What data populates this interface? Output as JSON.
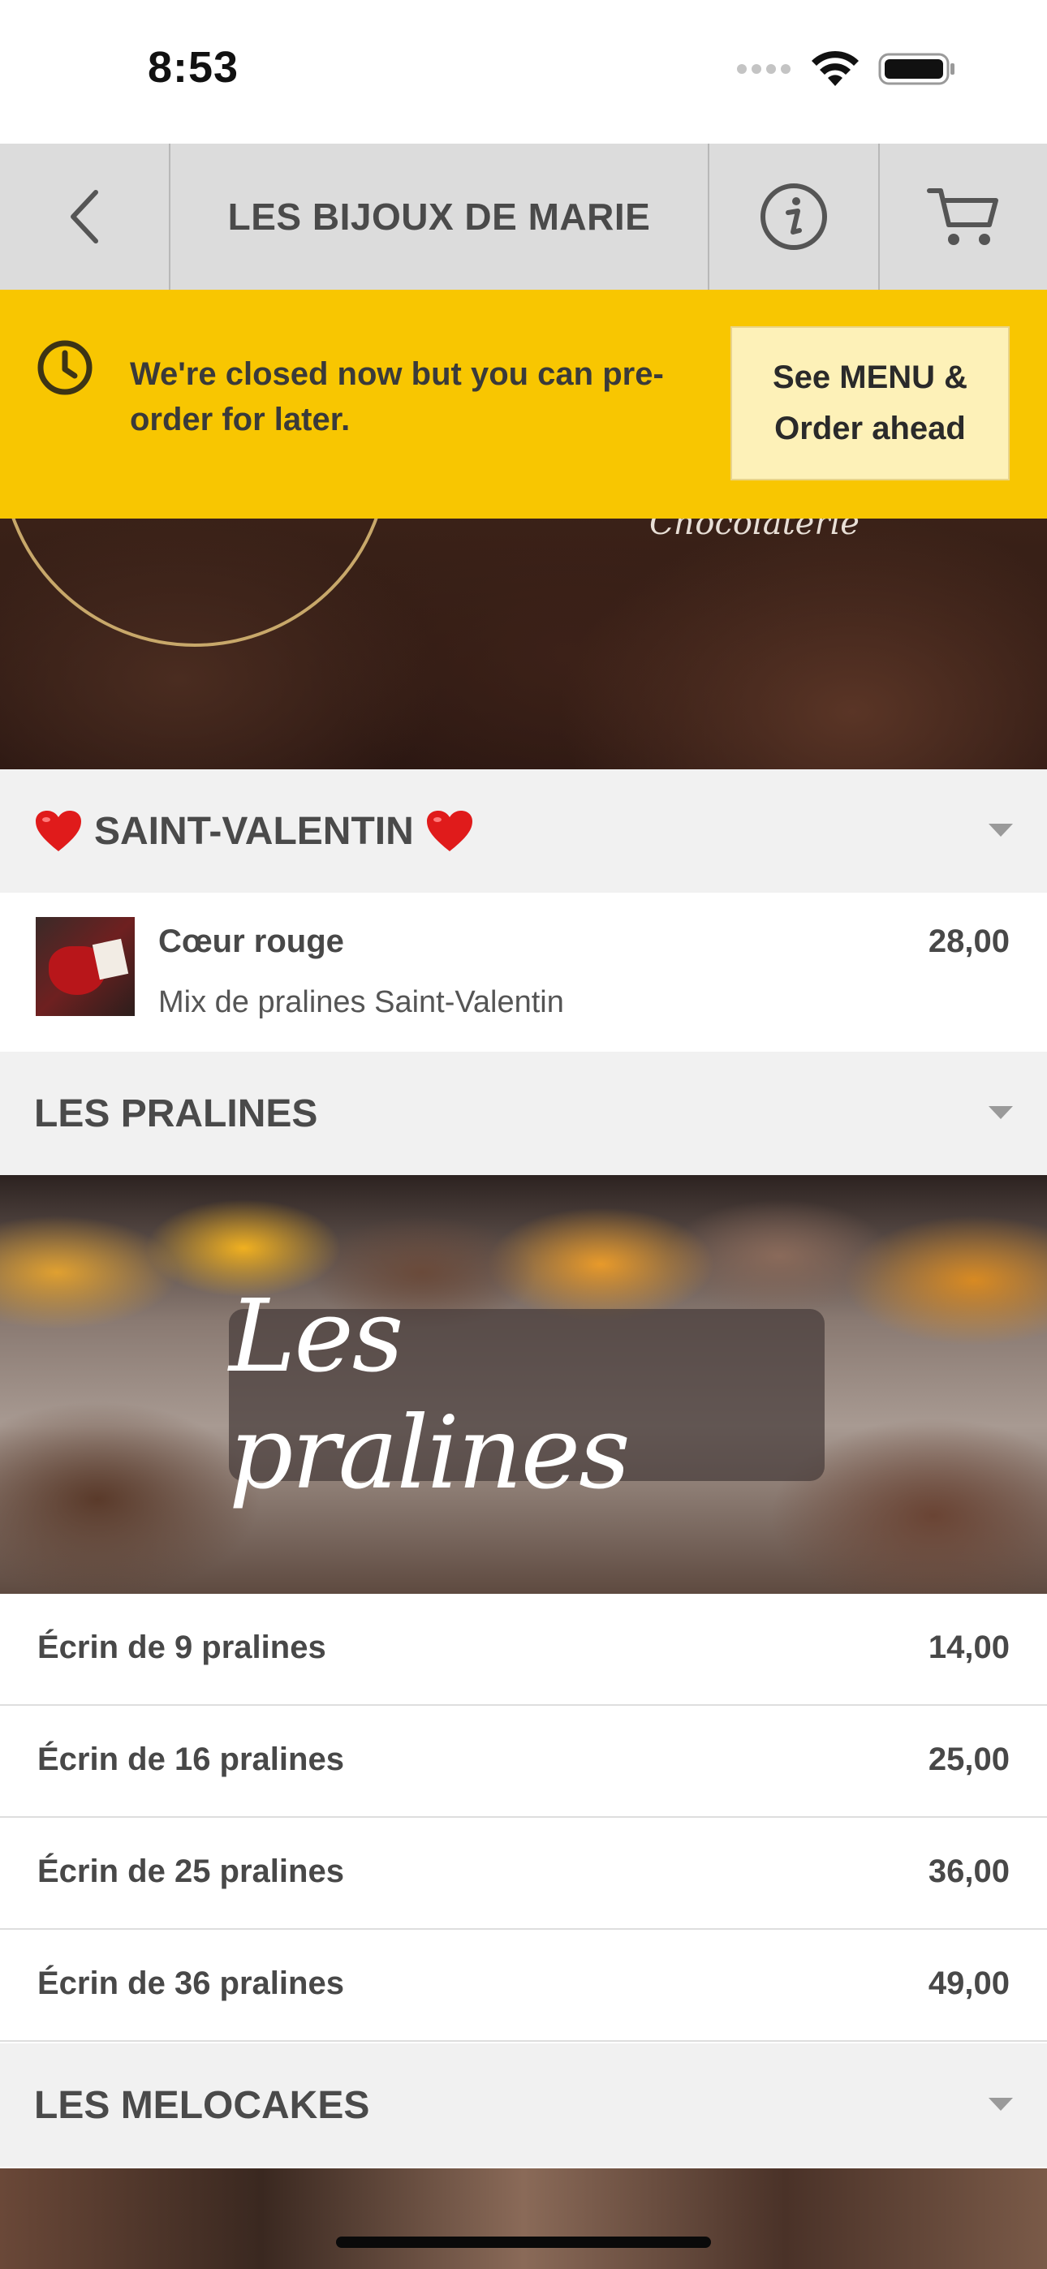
{
  "status_bar": {
    "time": "8:53"
  },
  "navbar": {
    "title": "LES BIJOUX DE MARIE"
  },
  "hero": {
    "subtitle": "Chocolaterie"
  },
  "closed_banner": {
    "message": "We're closed now but you can pre-order for later.",
    "button_label": "See MENU &\nOrder ahead"
  },
  "sections": [
    {
      "title": "SAINT-VALENTIN",
      "items": [
        {
          "name": "Cœur rouge",
          "description": "Mix de pralines Saint-Valentin",
          "price": "28,00"
        }
      ]
    },
    {
      "title": "LES PRALINES",
      "banner_text": "Les pralines",
      "items": [
        {
          "name": "Écrin de 9 pralines",
          "price": "14,00"
        },
        {
          "name": "Écrin de 16 pralines",
          "price": "25,00"
        },
        {
          "name": "Écrin de 25 pralines",
          "price": "36,00"
        },
        {
          "name": "Écrin de 36 pralines",
          "price": "49,00"
        }
      ]
    },
    {
      "title": "LES MELOCAKES",
      "items": []
    }
  ],
  "colors": {
    "banner_yellow": "#f8c601",
    "button_cream": "#fdf1b8",
    "navbar_grey": "#dcdcdc",
    "section_grey": "#f1f1f1",
    "heart_red": "#e01b1b"
  },
  "icons": [
    "back-chevron-icon",
    "info-icon",
    "cart-icon",
    "clock-icon",
    "heart-icon",
    "chevron-down-icon",
    "wifi-icon",
    "battery-icon",
    "cellular-icon"
  ]
}
